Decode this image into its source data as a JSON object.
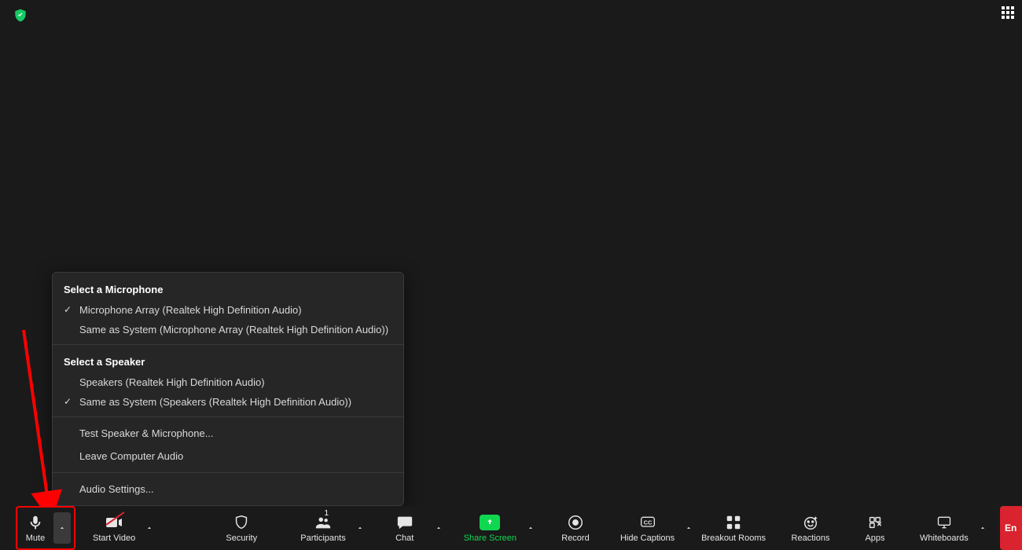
{
  "top": {
    "shield_color": "#17c964"
  },
  "audio_menu": {
    "mic_header": "Select a Microphone",
    "mic_options": [
      {
        "label": "Microphone Array (Realtek High Definition Audio)",
        "checked": true
      },
      {
        "label": "Same as System (Microphone Array (Realtek High Definition Audio))",
        "checked": false
      }
    ],
    "speaker_header": "Select a Speaker",
    "speaker_options": [
      {
        "label": "Speakers (Realtek High Definition Audio)",
        "checked": false
      },
      {
        "label": "Same as System (Speakers (Realtek High Definition Audio))",
        "checked": true
      }
    ],
    "test_label": "Test Speaker & Microphone...",
    "leave_label": "Leave Computer Audio",
    "settings_label": "Audio Settings..."
  },
  "toolbar": {
    "mute": "Mute",
    "start_video": "Start Video",
    "security": "Security",
    "participants": "Participants",
    "participants_count": "1",
    "chat": "Chat",
    "share_screen": "Share Screen",
    "record": "Record",
    "hide_captions": "Hide Captions",
    "breakout_rooms": "Breakout Rooms",
    "reactions": "Reactions",
    "apps": "Apps",
    "whiteboards": "Whiteboards",
    "end": "En"
  }
}
